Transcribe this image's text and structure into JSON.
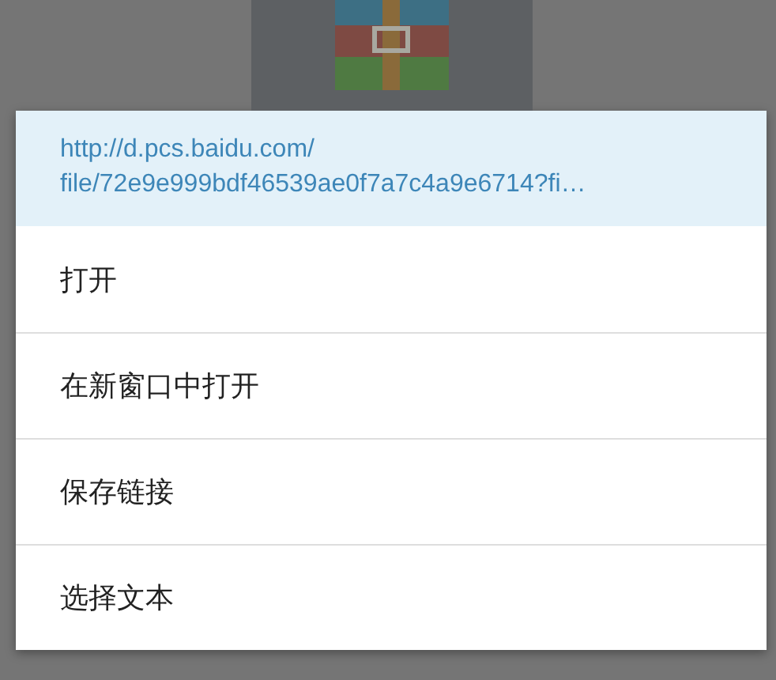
{
  "menu": {
    "url": "http://d.pcs.baidu.com/\nfile/72e9e999bdf46539ae0f7a7c4a9e6714?fi…",
    "items": [
      {
        "label": "打开"
      },
      {
        "label": "在新窗口中打开"
      },
      {
        "label": "保存链接"
      },
      {
        "label": "选择文本"
      }
    ]
  }
}
